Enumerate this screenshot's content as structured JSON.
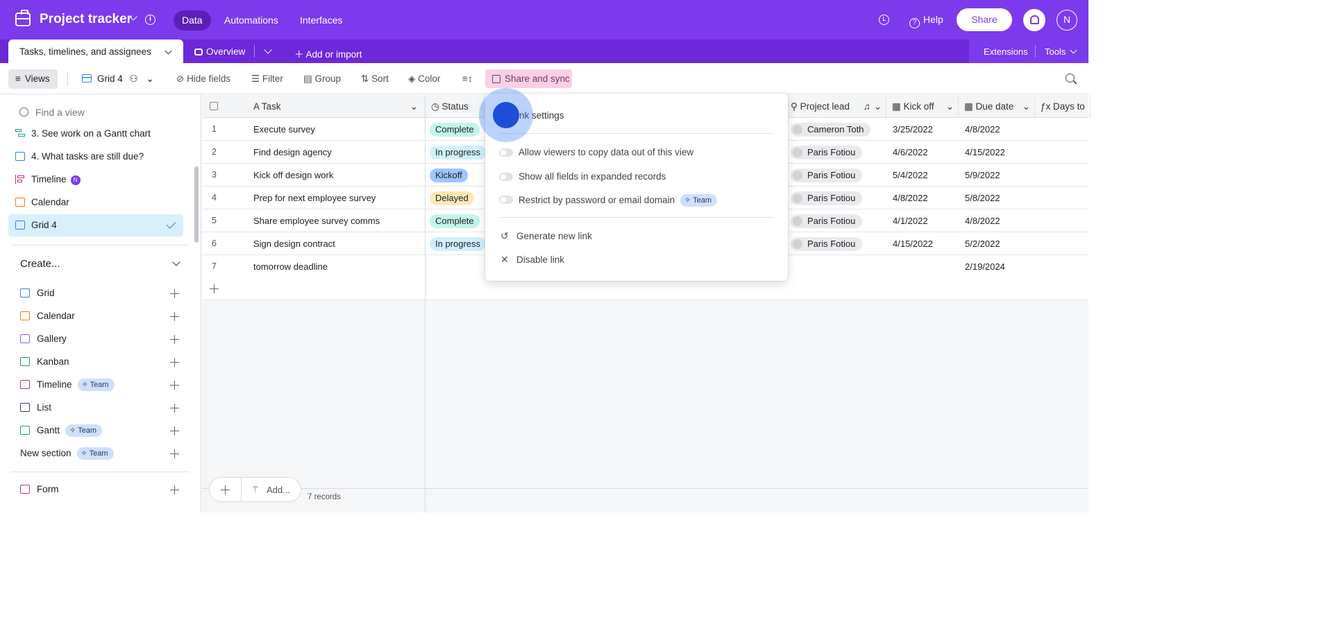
{
  "app": {
    "title": "Project tracker",
    "info_icon": "info-icon"
  },
  "nav": {
    "tabs": [
      "Data",
      "Automations",
      "Interfaces"
    ]
  },
  "topright": {
    "help": "Help",
    "share": "Share",
    "avatar": "N"
  },
  "tabs": {
    "table": "Tasks, timelines, and assignees",
    "overview": "Overview",
    "add_import": "Add or import",
    "extensions": "Extensions",
    "tools": "Tools"
  },
  "toolbar": {
    "views": "Views",
    "view_name": "Grid 4",
    "hide_fields": "Hide fields",
    "filter": "Filter",
    "group": "Group",
    "sort": "Sort",
    "color": "Color",
    "share_sync": "Share and sync"
  },
  "sidebar": {
    "find_placeholder": "Find a view",
    "views": [
      {
        "label": "3. See work on a Gantt chart",
        "icon": "gantt-icon"
      },
      {
        "label": "4. What tasks are still due?",
        "icon": "grid-icon"
      },
      {
        "label": "Timeline",
        "icon": "timeline-icon",
        "badge": "N"
      },
      {
        "label": "Calendar",
        "icon": "calendar-icon"
      },
      {
        "label": "Grid 4",
        "icon": "grid-icon",
        "selected": true
      }
    ],
    "create_label": "Create...",
    "create_items": [
      {
        "label": "Grid",
        "icon": "grid-icon"
      },
      {
        "label": "Calendar",
        "icon": "calendar-icon"
      },
      {
        "label": "Gallery",
        "icon": "gallery-icon"
      },
      {
        "label": "Kanban",
        "icon": "kanban-icon"
      },
      {
        "label": "Timeline",
        "icon": "timeline-icon",
        "badge": "Team"
      },
      {
        "label": "List",
        "icon": "list-icon"
      },
      {
        "label": "Gantt",
        "icon": "gantt-icon",
        "badge": "Team"
      },
      {
        "label": "New section",
        "badge": "Team"
      },
      {
        "label": "Form",
        "icon": "form-icon"
      }
    ]
  },
  "grid": {
    "columns": [
      "Task",
      "Status",
      "Project lead",
      "Kick off",
      "Due date",
      "Days to"
    ],
    "rows": [
      {
        "num": "1",
        "task": "Execute survey",
        "status": "Complete",
        "lead": "Cameron Toth",
        "kickoff": "3/25/2022",
        "due": "4/8/2022"
      },
      {
        "num": "2",
        "task": "Find design agency",
        "status": "In progress",
        "lead": "Paris Fotiou",
        "kickoff": "4/6/2022",
        "due": "4/15/2022"
      },
      {
        "num": "3",
        "task": "Kick off design work",
        "status": "Kickoff",
        "lead": "Paris Fotiou",
        "kickoff": "5/4/2022",
        "due": "5/9/2022"
      },
      {
        "num": "4",
        "task": "Prep for next employee survey",
        "status": "Delayed",
        "lead": "Paris Fotiou",
        "kickoff": "4/8/2022",
        "due": "5/8/2022"
      },
      {
        "num": "5",
        "task": "Share employee survey comms",
        "status": "Complete",
        "lead": "Paris Fotiou",
        "kickoff": "4/1/2022",
        "due": "4/8/2022"
      },
      {
        "num": "6",
        "task": "Sign design contract",
        "status": "In progress",
        "lead": "Paris Fotiou",
        "kickoff": "4/15/2022",
        "due": "5/2/2022"
      },
      {
        "num": "7",
        "task": "tomorrow deadline",
        "status": "",
        "lead": "",
        "kickoff": "",
        "due": "2/19/2024"
      }
    ],
    "status_colors": {
      "Complete": "#c2f5e9",
      "In progress": "#d0f0fd",
      "Kickoff": "#9cc7ff",
      "Delayed": "#ffeab6"
    },
    "footer_add": "Add...",
    "records": "7 records"
  },
  "popover": {
    "title": "ink settings",
    "toggles": [
      "Allow viewers to copy data out of this view",
      "Show all fields in expanded records",
      "Restrict by password or email domain"
    ],
    "restrict_badge": "Team",
    "actions": [
      "Generate new link",
      "Disable link"
    ]
  },
  "colors": {
    "brand": "#7c3aed",
    "selected_view": "#d7f0fb",
    "share_sync": "#fbcfe8"
  }
}
